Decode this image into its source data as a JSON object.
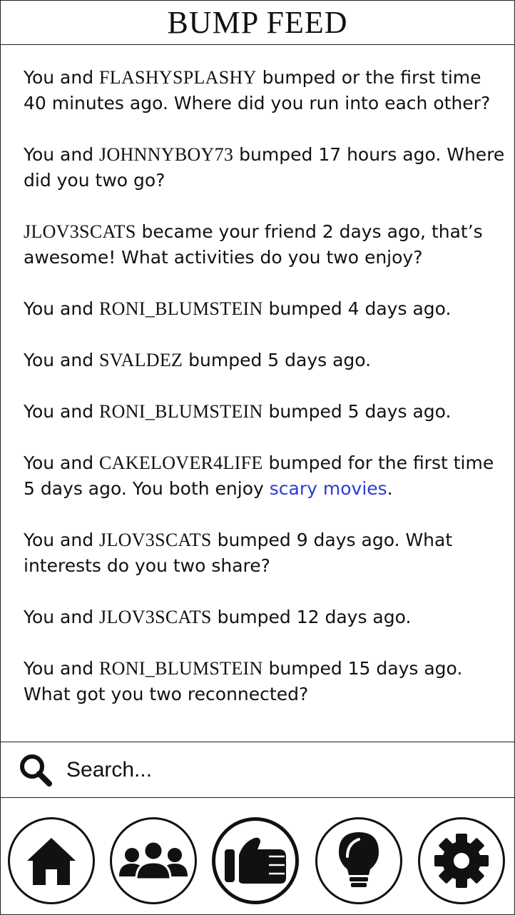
{
  "header": {
    "title": "BUMP FEED"
  },
  "feed": [
    {
      "pre": "You and ",
      "user": "FLASHYSPLASHY",
      "post": " bumped or the first time 40 minutes ago. Where did you run into each other?"
    },
    {
      "pre": "You and ",
      "user": "JOHNNYBOY73",
      "post": " bumped 17 hours ago. Where did you two go?"
    },
    {
      "pre": "",
      "user": "JLOV3SCATS",
      "post": " became your friend 2 days ago, that’s awesome! What activities do you two enjoy?"
    },
    {
      "pre": "You and ",
      "user": "RONI_BLUMSTEIN",
      "post": " bumped 4 days ago."
    },
    {
      "pre": "You and ",
      "user": "SVALDEZ",
      "post": " bumped 5 days ago."
    },
    {
      "pre": "You and ",
      "user": "RONI_BLUMSTEIN",
      "post": " bumped 5 days ago."
    },
    {
      "pre": "You and ",
      "user": "CAKELOVER4LIFE",
      "post": " bumped for the first time 5 days ago. You both enjoy ",
      "link": "scary movies",
      "tail": "."
    },
    {
      "pre": "You and ",
      "user": "JLOV3SCATS",
      "post": " bumped 9 days ago. What interests do you two share?"
    },
    {
      "pre": "You and ",
      "user": "JLOV3SCATS",
      "post": " bumped 12 days ago."
    },
    {
      "pre": "You and ",
      "user": "RONI_BLUMSTEIN",
      "post": " bumped 15 days ago. What got you two reconnected?"
    }
  ],
  "search": {
    "placeholder": "Search...",
    "icon": "search-icon"
  },
  "nav": [
    {
      "name": "home",
      "icon": "home-icon"
    },
    {
      "name": "friends",
      "icon": "people-icon"
    },
    {
      "name": "bump",
      "icon": "fist-bump-icon",
      "active": true
    },
    {
      "name": "ideas",
      "icon": "lightbulb-icon"
    },
    {
      "name": "settings",
      "icon": "gear-icon"
    }
  ],
  "colors": {
    "link": "#2a3bd6",
    "text": "#111111",
    "border": "#222222"
  }
}
